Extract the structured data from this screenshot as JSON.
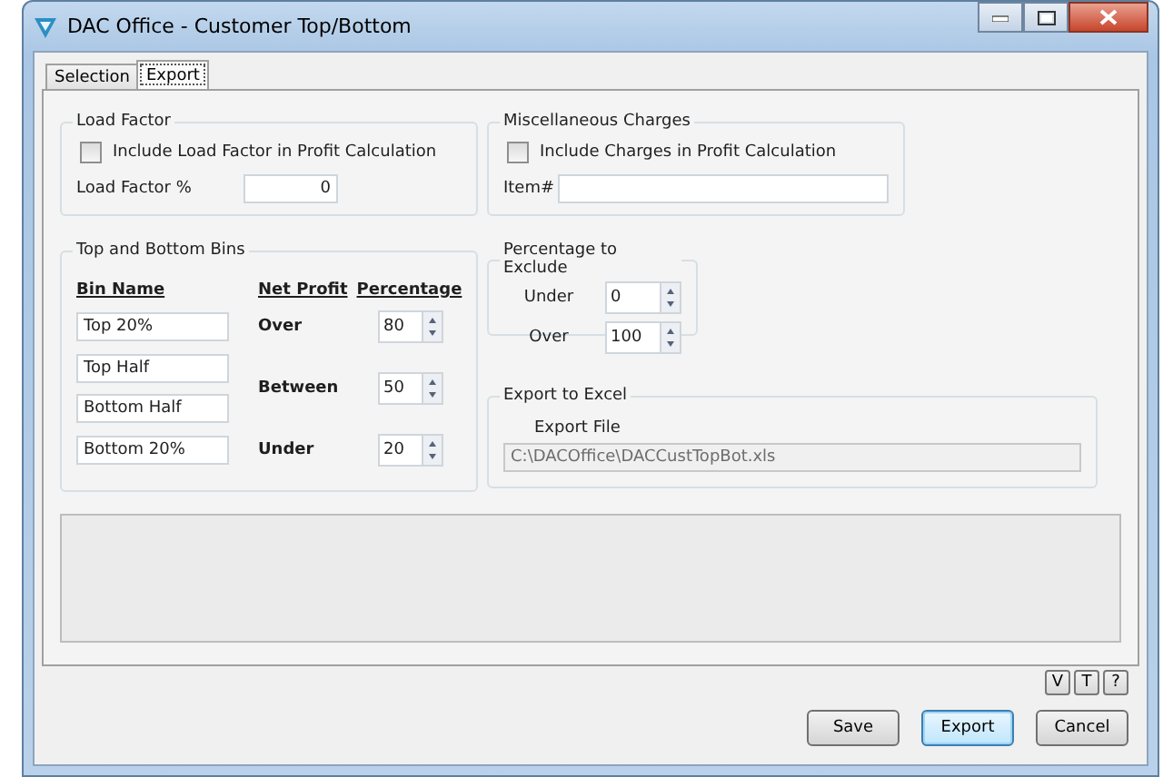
{
  "window": {
    "title": "DAC Office - Customer Top/Bottom"
  },
  "tabs": [
    {
      "label": "Selection",
      "selected": false
    },
    {
      "label": "Export",
      "selected": true
    }
  ],
  "load_factor": {
    "title": "Load Factor",
    "checkbox": {
      "label": "Include Load Factor in Profit Calculation",
      "checked": false
    },
    "field_label": "Load Factor %",
    "value": "0"
  },
  "misc_charges": {
    "title": "Miscellaneous Charges",
    "checkbox": {
      "label": "Include Charges in Profit Calculation",
      "checked": false
    },
    "field_label": "Item#"
  },
  "bins": {
    "title": "Top and Bottom Bins",
    "name_header": "Bin Name",
    "profit_header": "Net Profit",
    "percentage_header": "Percentage",
    "names": [
      "Top 20%",
      "Top Half",
      "Bottom Half",
      "Bottom 20%"
    ],
    "thresholds": [
      {
        "label": "Over",
        "value": "80"
      },
      {
        "label": "Between",
        "value": "50"
      },
      {
        "label": "Under",
        "value": "20"
      }
    ]
  },
  "exclude": {
    "title": "Percentage to Exclude",
    "rows": [
      {
        "label": "Under",
        "value": "0"
      },
      {
        "label": "Over",
        "value": "100"
      }
    ]
  },
  "export": {
    "title": "Export to Excel",
    "field_label": "Export File",
    "value": "C:\\DACOffice\\DACCustTopBot.xls"
  },
  "small_buttons": [
    "V",
    "T",
    "?"
  ],
  "buttons": [
    {
      "label": "Save",
      "default": false
    },
    {
      "label": "Export",
      "default": true
    },
    {
      "label": "Cancel",
      "default": false
    }
  ]
}
